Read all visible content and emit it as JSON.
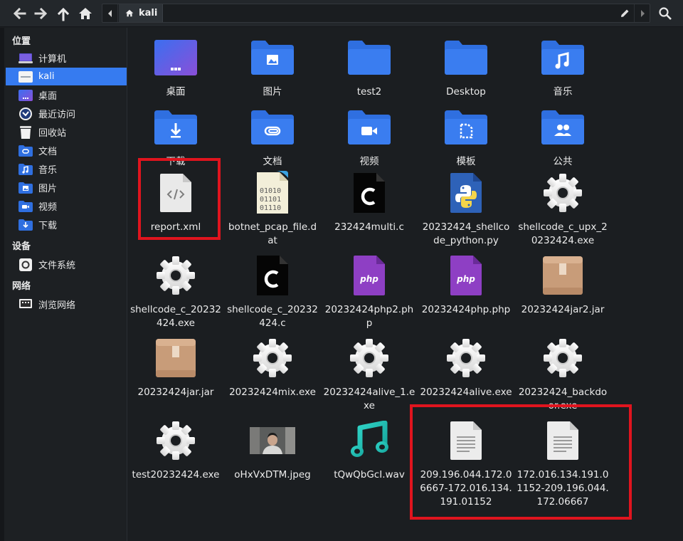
{
  "toolbar": {
    "back_icon": "arrow-left-icon",
    "forward_icon": "arrow-right-icon",
    "up_icon": "arrow-up-icon",
    "home_icon": "home-icon",
    "path_segment": "kali",
    "search_icon": "search-icon"
  },
  "sidebar": {
    "headings": {
      "places": "位置",
      "devices": "设备",
      "network": "网络"
    },
    "places": [
      {
        "label": "计算机",
        "icon": "computer-icon"
      },
      {
        "label": "kali",
        "icon": "home-folder-icon",
        "active": true
      },
      {
        "label": "桌面",
        "icon": "desktop-icon"
      },
      {
        "label": "最近访问",
        "icon": "recent-icon"
      },
      {
        "label": "回收站",
        "icon": "trash-icon"
      },
      {
        "label": "文档",
        "icon": "documents-icon"
      },
      {
        "label": "音乐",
        "icon": "music-icon"
      },
      {
        "label": "图片",
        "icon": "pictures-icon"
      },
      {
        "label": "视频",
        "icon": "videos-icon"
      },
      {
        "label": "下载",
        "icon": "downloads-icon"
      }
    ],
    "devices": [
      {
        "label": "文件系统",
        "icon": "drive-icon"
      }
    ],
    "network": [
      {
        "label": "浏览网络",
        "icon": "network-icon"
      }
    ]
  },
  "files": [
    {
      "name": "桌面",
      "icon": "desktop-folder"
    },
    {
      "name": "图片",
      "icon": "folder-pictures"
    },
    {
      "name": "test2",
      "icon": "folder"
    },
    {
      "name": "Desktop",
      "icon": "folder"
    },
    {
      "name": "音乐",
      "icon": "folder-music"
    },
    {
      "name": "下载",
      "icon": "folder-downloads"
    },
    {
      "name": "文档",
      "icon": "folder-documents"
    },
    {
      "name": "视频",
      "icon": "folder-videos"
    },
    {
      "name": "模板",
      "icon": "folder-templates"
    },
    {
      "name": "公共",
      "icon": "folder-public"
    },
    {
      "name": "report.xml",
      "icon": "xml-file"
    },
    {
      "name": "botnet_pcap_file.dat",
      "icon": "binary-file"
    },
    {
      "name": "232424multi.c",
      "icon": "c-source"
    },
    {
      "name": "20232424_shellcode_python.py",
      "icon": "python-file"
    },
    {
      "name": "shellcode_c_upx_20232424.exe",
      "icon": "exe-gear"
    },
    {
      "name": "shellcode_c_20232424.exe",
      "icon": "exe-gear"
    },
    {
      "name": "shellcode_c_20232424.c",
      "icon": "c-source"
    },
    {
      "name": "20232424php2.php",
      "icon": "php-file"
    },
    {
      "name": "20232424php.php",
      "icon": "php-file"
    },
    {
      "name": "20232424jar2.jar",
      "icon": "jar-file"
    },
    {
      "name": "20232424jar.jar",
      "icon": "jar-file"
    },
    {
      "name": "20232424mix.exe",
      "icon": "exe-gear"
    },
    {
      "name": "20232424alive_1.exe",
      "icon": "exe-gear"
    },
    {
      "name": "20232424alive.exe",
      "icon": "exe-gear"
    },
    {
      "name": "20232424_backdoor.exe",
      "icon": "exe-gear"
    },
    {
      "name": "test20232424.exe",
      "icon": "exe-gear"
    },
    {
      "name": "oHxVxDTM.jpeg",
      "icon": "image-thumbnail"
    },
    {
      "name": "tQwQbGcI.wav",
      "icon": "audio-file"
    },
    {
      "name": "209.196.044.172.06667-172.016.134.191.01152",
      "icon": "text-file"
    },
    {
      "name": "172.016.134.191.01152-209.196.044.172.06667",
      "icon": "text-file"
    }
  ],
  "colors": {
    "accent": "#367bf0",
    "folder": "#2f6fe0",
    "highlight_box": "#e0141e"
  }
}
